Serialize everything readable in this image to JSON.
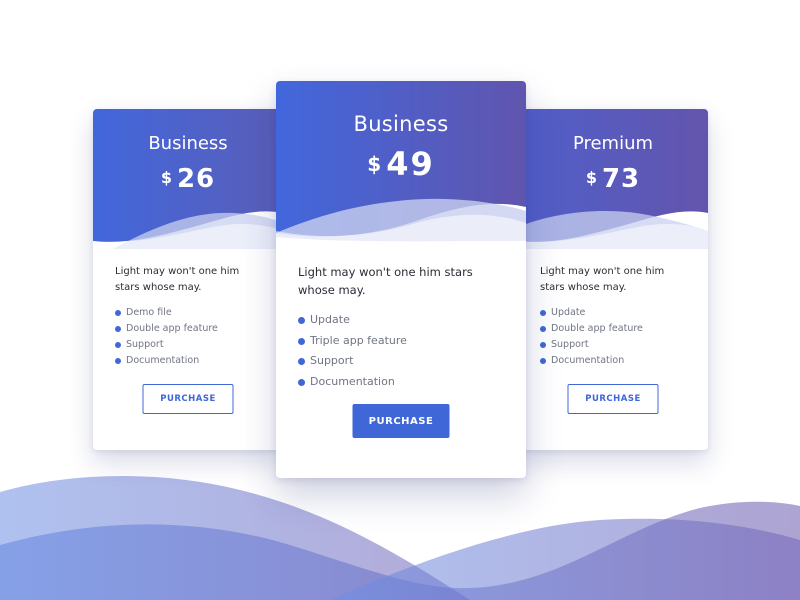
{
  "colors": {
    "accent": "#3f67d8",
    "gradient_start": "#4267dc",
    "gradient_end": "#6055ae",
    "background": "#ffffff"
  },
  "plans": [
    {
      "name": "Business",
      "currency": "$",
      "price": "26",
      "description": "Light may won't one him stars whose may.",
      "features": [
        "Demo file",
        "Double app feature",
        "Support",
        "Documentation"
      ],
      "button_label": "PURCHASE"
    },
    {
      "name": "Business",
      "currency": "$",
      "price": "49",
      "description": "Light may won't one him stars whose may.",
      "features": [
        "Update",
        "Triple app feature",
        "Support",
        "Documentation"
      ],
      "button_label": "PURCHASE"
    },
    {
      "name": "Premium",
      "currency": "$",
      "price": "73",
      "description": "Light may won't one him stars whose may.",
      "features": [
        "Update",
        "Double app feature",
        "Support",
        "Documentation"
      ],
      "button_label": "PURCHASE"
    }
  ]
}
